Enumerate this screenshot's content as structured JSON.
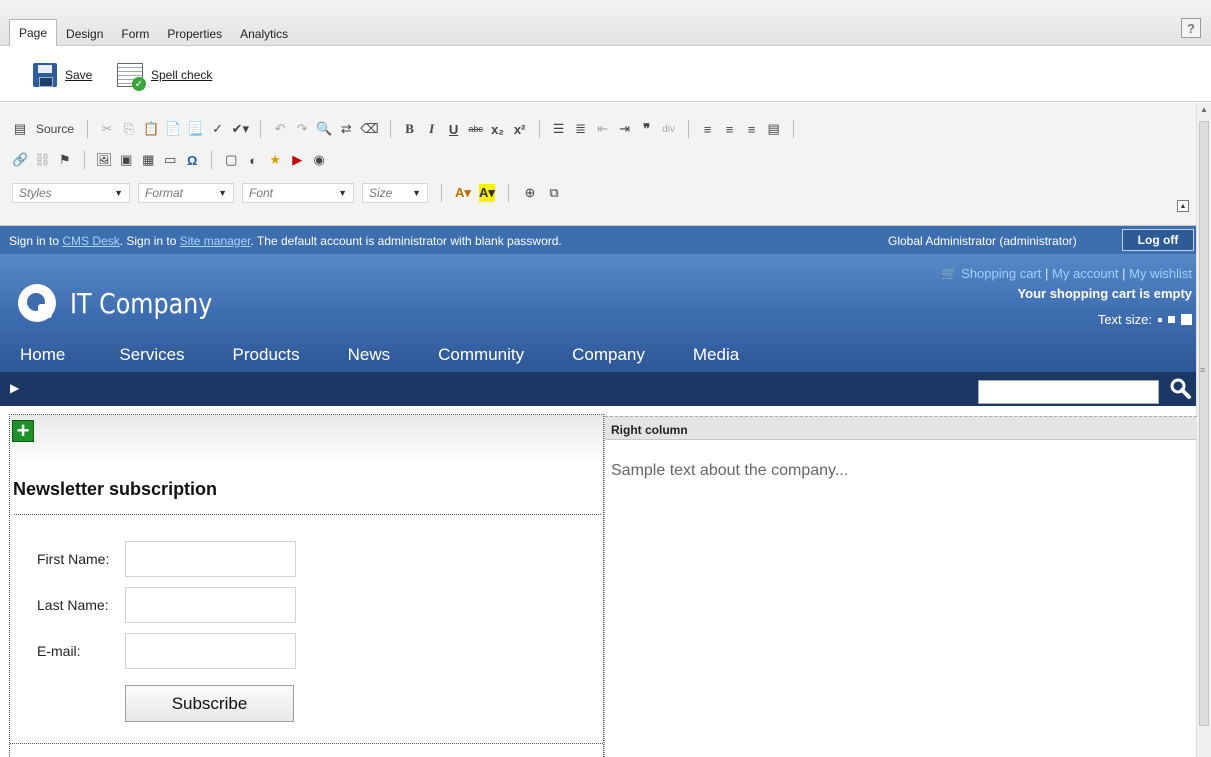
{
  "tabs": [
    {
      "label": "Page",
      "active": true
    },
    {
      "label": "Design",
      "active": false
    },
    {
      "label": "Form",
      "active": false
    },
    {
      "label": "Properties",
      "active": false
    },
    {
      "label": "Analytics",
      "active": false
    }
  ],
  "help_label": "?",
  "actions": {
    "save_label": "Save",
    "spellcheck_label": "Spell check"
  },
  "editor_toolbar": {
    "source_label": "Source",
    "styles_label": "Styles",
    "format_label": "Format",
    "font_label": "Font",
    "size_label": "Size"
  },
  "signin": {
    "prefix1": "Sign in to ",
    "link1": "CMS Desk",
    "mid": ". Sign in to ",
    "link2": "Site manager",
    "suffix": ". The default account is administrator with blank password.",
    "user": "Global Administrator (administrator)",
    "logoff_label": "Log off"
  },
  "site": {
    "company_name": "IT Company",
    "cart_links": [
      "Shopping cart",
      "My account",
      "My wishlist"
    ],
    "cart_status": "Your shopping cart is empty",
    "text_size_label": "Text size:",
    "nav": [
      "Home",
      "Services",
      "Products",
      "News",
      "Community",
      "Company",
      "Media"
    ]
  },
  "newsletter": {
    "title": "Newsletter subscription",
    "first_name_label": "First Name:",
    "last_name_label": "Last Name:",
    "email_label": "E-mail:",
    "subscribe_label": "Subscribe"
  },
  "right_column": {
    "header": "Right column",
    "text": "Sample text about the company..."
  },
  "colors": {
    "header_blue": "#3d6cae",
    "nav_dark": "#1b3765",
    "link_blue": "#9fd0ff",
    "add_green": "#1f8f2a"
  }
}
